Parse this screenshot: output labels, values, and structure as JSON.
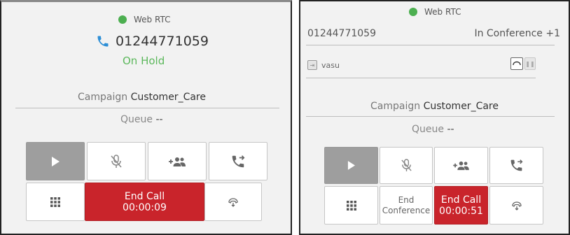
{
  "left_panel": {
    "connection": "Web RTC",
    "phone_number": "01244771059",
    "call_status": "On Hold",
    "campaign_label": "Campaign",
    "campaign_value": "Customer_Care",
    "queue_label": "Queue",
    "queue_value": "--",
    "end_call_label": "End Call",
    "end_call_timer": "00:00:09"
  },
  "right_panel": {
    "connection": "Web RTC",
    "phone_number": "01244771059",
    "conference_status": "In Conference +1",
    "participant_name": "vasu",
    "campaign_label": "Campaign",
    "campaign_value": "Customer_Care",
    "queue_label": "Queue",
    "queue_value": "--",
    "end_conference_line1": "End",
    "end_conference_line2": "Conference",
    "end_call_label": "End Call",
    "end_call_timer": "00:00:51"
  },
  "colors": {
    "online_dot": "#4caf50",
    "on_hold_text": "#5cb85c",
    "end_call_bg": "#c9242b",
    "phone_icon": "#2e8fd6",
    "play_button_bg": "#9e9e9e"
  },
  "icons": [
    "play-icon",
    "mute-icon",
    "add-participant-icon",
    "transfer-icon",
    "dialpad-icon",
    "hangup-icon",
    "phone-icon",
    "hold-icon",
    "participant-icon"
  ]
}
